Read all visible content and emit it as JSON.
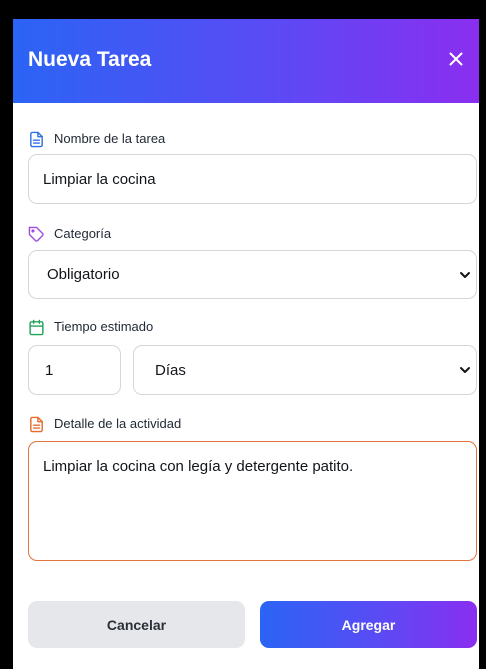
{
  "modal": {
    "title": "Nueva Tarea",
    "close_icon": "close-icon"
  },
  "task_name": {
    "label": "Nombre de la tarea",
    "icon": "document-icon",
    "icon_color": "#2f6fe8",
    "value": "Limpiar la cocina"
  },
  "category": {
    "label": "Categoría",
    "icon": "tag-icon",
    "icon_color": "#a34be0",
    "selected": "Obligatorio"
  },
  "estimated_time": {
    "label": "Tiempo estimado",
    "icon": "calendar-icon",
    "icon_color": "#23a25a",
    "amount": "1",
    "unit": "Días"
  },
  "activity_detail": {
    "label": "Detalle de la actividad",
    "icon": "document-icon",
    "icon_color": "#e86a2c",
    "value": "Limpiar la cocina con legía y detergente patito."
  },
  "actions": {
    "cancel_label": "Cancelar",
    "add_label": "Agregar"
  },
  "colors": {
    "accent_start": "#2b64f5",
    "accent_end": "#8a2ef0",
    "textarea_border": "#e2753a"
  }
}
